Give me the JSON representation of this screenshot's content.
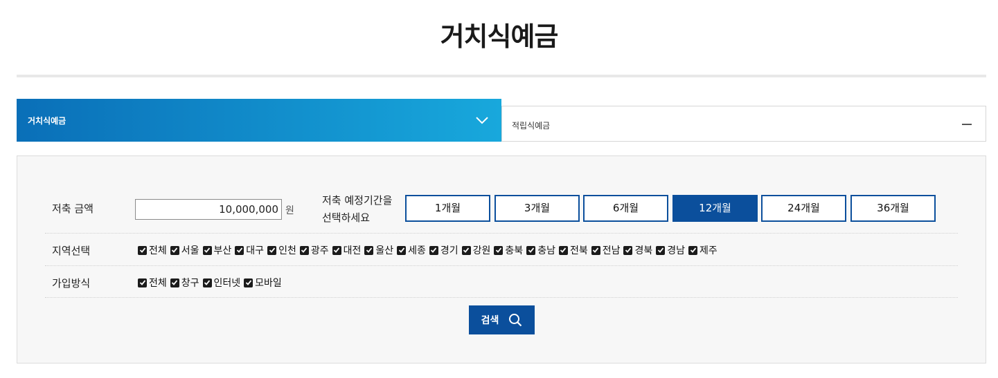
{
  "page": {
    "title": "거치식예금"
  },
  "tabs": {
    "active": {
      "label": "거치식예금",
      "icon": "chevron-down-icon"
    },
    "inactive": {
      "label": "적립식예금",
      "icon": "minus-icon"
    }
  },
  "filter": {
    "amount": {
      "label": "저축 금액",
      "value": "10,000,000",
      "unit": "원"
    },
    "period": {
      "label_line1": "저축 예정기간을",
      "label_line2": "선택하세요",
      "options": [
        "1개월",
        "3개월",
        "6개월",
        "12개월",
        "24개월",
        "36개월"
      ],
      "selected": "12개월"
    },
    "region": {
      "label": "지역선택",
      "options": [
        "전체",
        "서울",
        "부산",
        "대구",
        "인천",
        "광주",
        "대전",
        "울산",
        "세종",
        "경기",
        "강원",
        "충북",
        "충남",
        "전북",
        "전남",
        "경북",
        "경남",
        "제주"
      ]
    },
    "join": {
      "label": "가입방식",
      "options": [
        "전체",
        "창구",
        "인터넷",
        "모바일"
      ]
    },
    "search": {
      "label": "검색",
      "icon": "search-icon"
    }
  },
  "colors": {
    "primary": "#0b4f9c",
    "gradient_start": "#0a6fb8",
    "gradient_end": "#18a8dc",
    "panel_bg": "#f7f7f7"
  }
}
